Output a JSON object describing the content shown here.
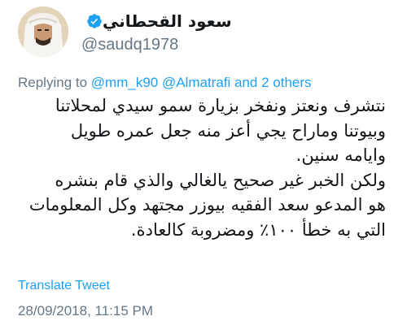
{
  "author": {
    "display_name": "سعود القحطاني",
    "handle": "@saudq1978",
    "verified": true,
    "avatar_icon": "profile-photo"
  },
  "reply": {
    "prefix": "Replying to ",
    "mention_1": "@mm_k90",
    "mention_2": "@Almatrafi",
    "suffix": " and 2 others"
  },
  "tweet": {
    "lines": [
      "نتشرف ونعتز ونفخر بزيارة سمو سيدي لمحلاتنا",
      "وبيوتنا وماراح يجي أعز منه جعل عمره طويل",
      "وايامه سنين.",
      "ولكن الخبر غير صحيح يالغالي والذي قام بنشره",
      "هو المدعو سعد الفقيه بيوزر مجتهد وكل المعلومات",
      "التي به خطأ ١٠٠٪ ومضروبة كالعادة."
    ]
  },
  "actions": {
    "translate_label": "Translate Tweet"
  },
  "meta": {
    "timestamp": "28/09/2018, 11:15 PM"
  },
  "colors": {
    "text": "#14171a",
    "secondary": "#657786",
    "accent": "#1da1f2"
  }
}
